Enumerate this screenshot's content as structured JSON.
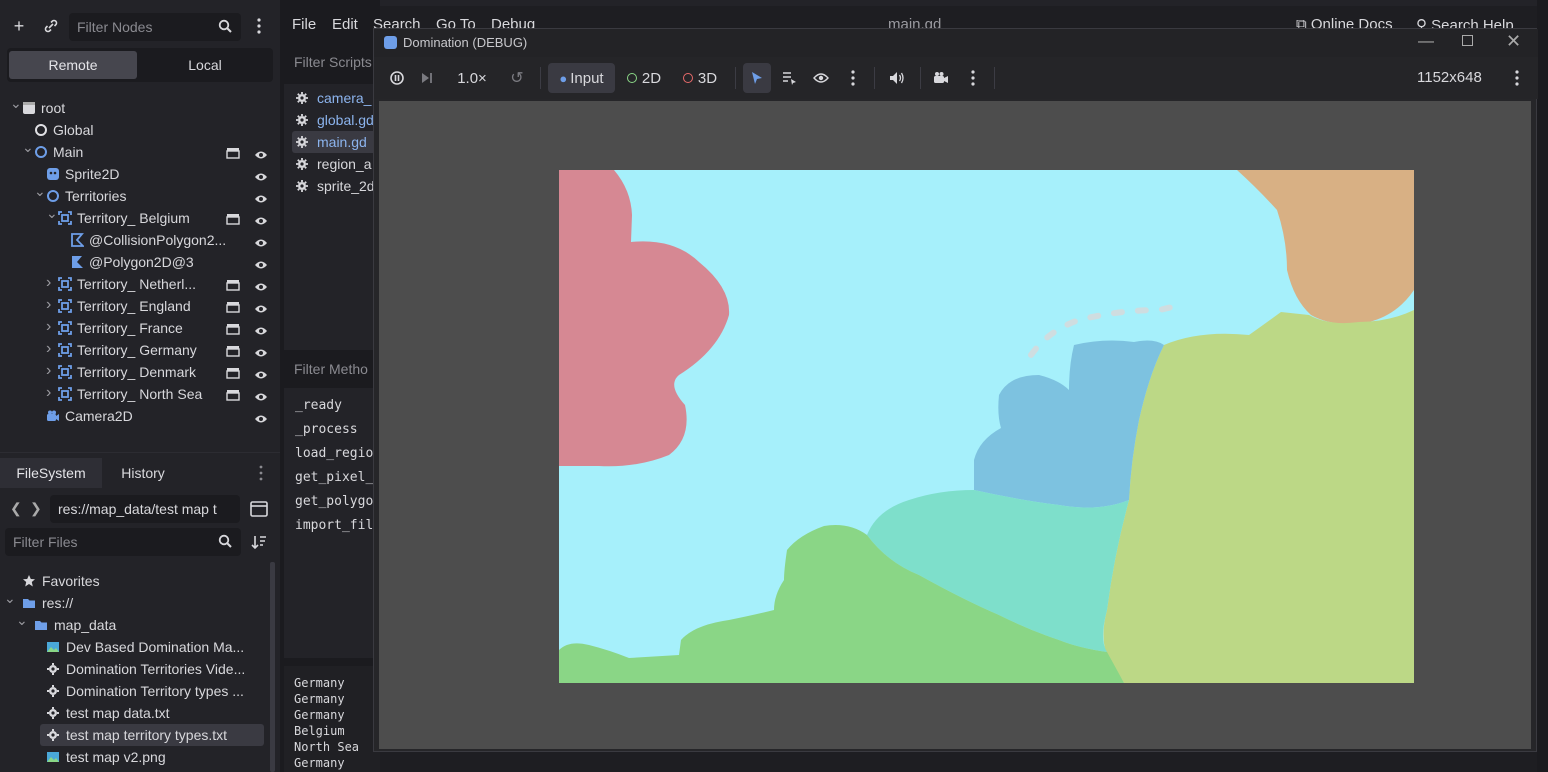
{
  "left_panel": {
    "filter_nodes_placeholder": "Filter Nodes",
    "remote_label": "Remote",
    "local_label": "Local",
    "scene_tree": [
      {
        "label": "root",
        "icon": "window-icon",
        "arrow": "expanded"
      },
      {
        "label": "Global",
        "icon": "node-icon"
      },
      {
        "label": "Main",
        "icon": "node2d-icon",
        "arrow": "expanded"
      },
      {
        "label": "Sprite2D",
        "icon": "sprite-icon"
      },
      {
        "label": "Territories",
        "icon": "node2d-icon",
        "arrow": "expanded"
      },
      {
        "label": "Territory_ Belgium",
        "icon": "area-icon",
        "arrow": "expanded"
      },
      {
        "label": "@CollisionPolygon2...",
        "icon": "collision-polygon-icon"
      },
      {
        "label": "@Polygon2D@3",
        "icon": "polygon-icon"
      },
      {
        "label": "Territory_ Netherl...",
        "icon": "area-icon",
        "arrow": "collapsed"
      },
      {
        "label": "Territory_ England",
        "icon": "area-icon",
        "arrow": "collapsed"
      },
      {
        "label": "Territory_ France",
        "icon": "area-icon",
        "arrow": "collapsed"
      },
      {
        "label": "Territory_ Germany",
        "icon": "area-icon",
        "arrow": "collapsed"
      },
      {
        "label": "Territory_ Denmark",
        "icon": "area-icon",
        "arrow": "collapsed"
      },
      {
        "label": "Territory_ North Sea",
        "icon": "area-icon",
        "arrow": "collapsed"
      },
      {
        "label": "Camera2D",
        "icon": "camera-icon"
      }
    ],
    "fs_tabs": [
      "FileSystem",
      "History"
    ],
    "path": "res://map_data/test map t",
    "filter_files_placeholder": "Filter Files",
    "files": [
      {
        "label": "Favorites",
        "icon": "star-icon"
      },
      {
        "label": "res://",
        "icon": "folder-icon",
        "arrow": "expanded"
      },
      {
        "label": "map_data",
        "icon": "folder-icon",
        "arrow": "expanded"
      },
      {
        "label": "Dev Based Domination Ma...",
        "icon": "image-icon"
      },
      {
        "label": "Domination Territories Vide...",
        "icon": "file-icon"
      },
      {
        "label": "Domination Territory types ...",
        "icon": "file-icon"
      },
      {
        "label": "test map data.txt",
        "icon": "file-icon"
      },
      {
        "label": "test map territory types.txt",
        "icon": "file-icon",
        "selected": true
      },
      {
        "label": "test map v2.png",
        "icon": "image-icon"
      }
    ]
  },
  "editor": {
    "menu": [
      "File",
      "Edit",
      "Search",
      "Go To",
      "Debug"
    ],
    "current_file": "main.gd",
    "online_docs": "Online Docs",
    "search_help": "Search Help",
    "filter_scripts_placeholder": "Filter Scripts",
    "scripts": [
      "camera_",
      "global.gd",
      "main.gd",
      "region_a",
      "sprite_2d"
    ],
    "filter_methods_placeholder": "Filter Metho",
    "methods": [
      "_ready",
      "_process",
      "load_regio",
      "get_pixel_",
      "get_polygo",
      "import_fil"
    ],
    "output_lines": [
      "Germany",
      "Germany",
      "Germany",
      "Belgium",
      "North Sea",
      "Germany"
    ]
  },
  "debug_window": {
    "title": "Domination (DEBUG)",
    "speed": "1.0×",
    "input_label": "Input",
    "label_2d": "2D",
    "label_3d": "3D",
    "resolution": "1152x648"
  },
  "colors": {
    "accent": "#6e9ee8",
    "sea": "#a6f0fb",
    "belgium": "#d68893",
    "england": "#d8b084",
    "germany": "#bcd886",
    "netherlands": "#7dc2e0",
    "france": "#8ad686",
    "denmark": "#7edfcb"
  }
}
